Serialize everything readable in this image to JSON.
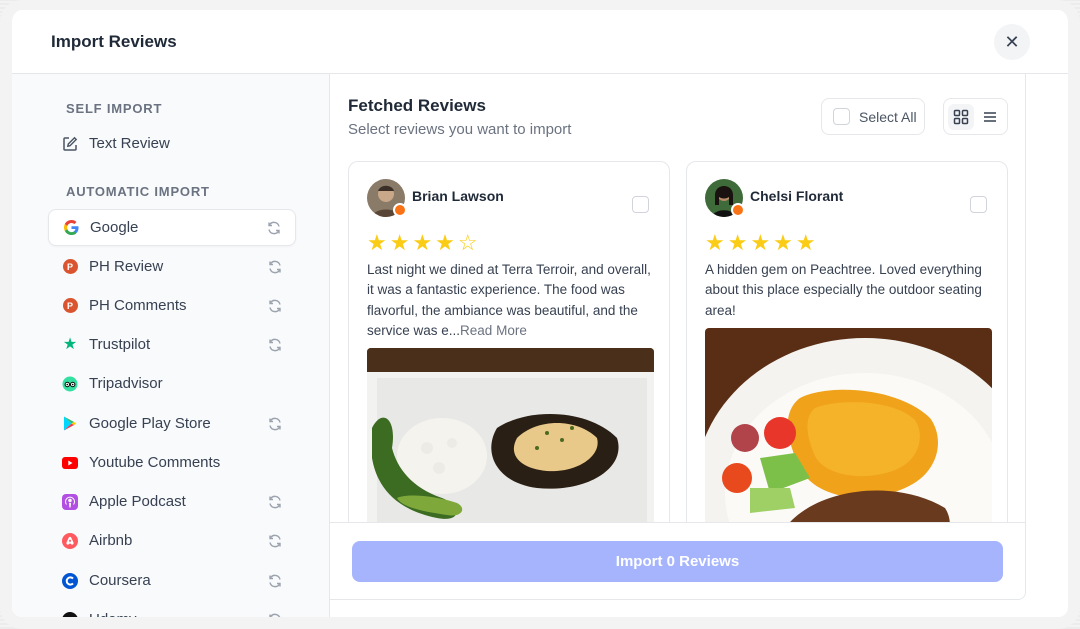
{
  "modal": {
    "title": "Import Reviews"
  },
  "sidebar": {
    "self_import_label": "SELF IMPORT",
    "self_items": [
      {
        "label": "Text Review",
        "icon": "edit-icon"
      }
    ],
    "auto_import_label": "AUTOMATIC IMPORT",
    "auto_items": [
      {
        "label": "Google",
        "icon": "google-icon",
        "sync": true,
        "active": true
      },
      {
        "label": "PH Review",
        "icon": "producthunt-icon",
        "sync": true
      },
      {
        "label": "PH Comments",
        "icon": "producthunt-icon",
        "sync": true
      },
      {
        "label": "Trustpilot",
        "icon": "trustpilot-icon",
        "sync": true
      },
      {
        "label": "Tripadvisor",
        "icon": "tripadvisor-icon",
        "sync": false
      },
      {
        "label": "Google Play Store",
        "icon": "google-play-icon",
        "sync": true
      },
      {
        "label": "Youtube Comments",
        "icon": "youtube-icon",
        "sync": false
      },
      {
        "label": "Apple Podcast",
        "icon": "apple-podcast-icon",
        "sync": true
      },
      {
        "label": "Airbnb",
        "icon": "airbnb-icon",
        "sync": true
      },
      {
        "label": "Coursera",
        "icon": "coursera-icon",
        "sync": true
      },
      {
        "label": "Udemy",
        "icon": "udemy-icon",
        "sync": true
      }
    ]
  },
  "main": {
    "title": "Fetched Reviews",
    "subtitle": "Select reviews you want to import",
    "select_all_label": "Select All",
    "reviews": [
      {
        "name": "Brian Lawson",
        "rating": 4,
        "stars": "★★★★☆",
        "text": "Last night we dined at Terra Terroir, and overall, it was a fantastic experience. The food was flavorful, the ambiance was beautiful, and the service was e",
        "ellipsis": "...",
        "read_more": "Read More"
      },
      {
        "name": "Chelsi Florant",
        "rating": 5,
        "stars": "★★★★★",
        "text": "A hidden gem on Peachtree. Loved everything about this place especially the outdoor seating area!"
      }
    ],
    "import_button_label": "Import 0 Reviews"
  },
  "colors": {
    "accent_disabled": "#a5b4fc",
    "star": "#facc15",
    "producthunt": "#da552f",
    "trustpilot": "#00b67a",
    "youtube": "#ff0000"
  }
}
